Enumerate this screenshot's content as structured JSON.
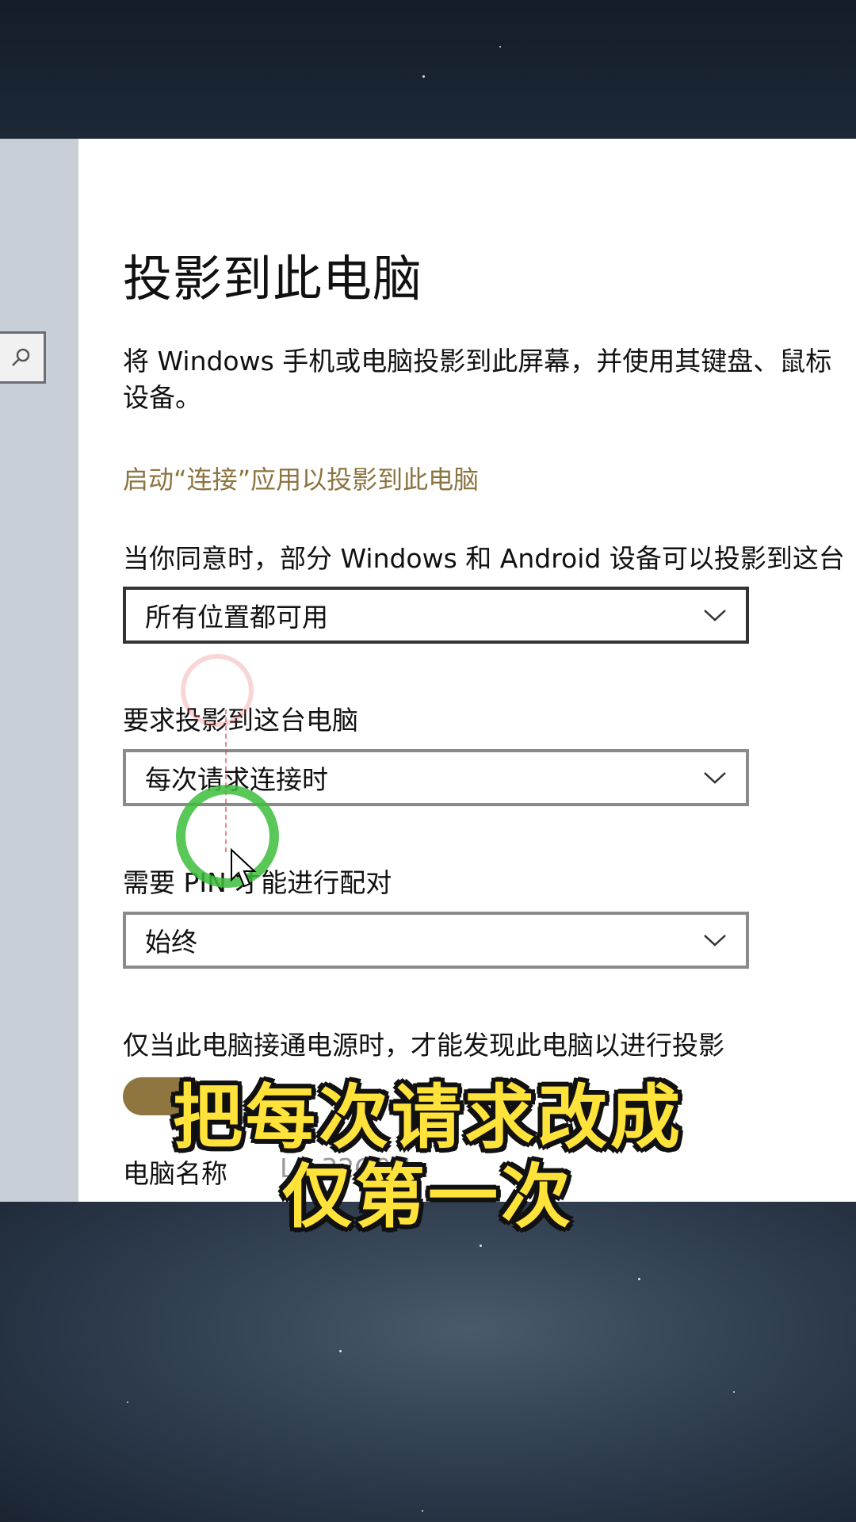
{
  "settings": {
    "title": "投影到此电脑",
    "description_line1": "将 Windows 手机或电脑投影到此屏幕，并使用其键盘、鼠标",
    "description_line2": "设备。",
    "launch_link": "启动“连接”应用以投影到此电脑",
    "availability_label": "当你同意时，部分 Windows 和 Android 设备可以投影到这台",
    "availability_value": "所有位置都可用",
    "ask_label": "要求投影到这台电脑",
    "ask_value": "每次请求连接时",
    "pin_label": "需要 PIN 才能进行配对",
    "pin_value": "始终",
    "power_label": "仅当此电脑接通电源时，才能发现此电脑以进行投影",
    "power_toggle": "on",
    "pc_name_label": "电脑名称",
    "pc_name_value": "LA      32G0N"
  },
  "caption": {
    "line1": "把每次请求改成",
    "line2": "仅第一次"
  },
  "icons": {
    "search": "search-icon",
    "chevron": "chevron-down-icon",
    "cursor": "mouse-cursor-icon"
  },
  "colors": {
    "accent": "#8c7440",
    "caption": "#ffe23a"
  }
}
